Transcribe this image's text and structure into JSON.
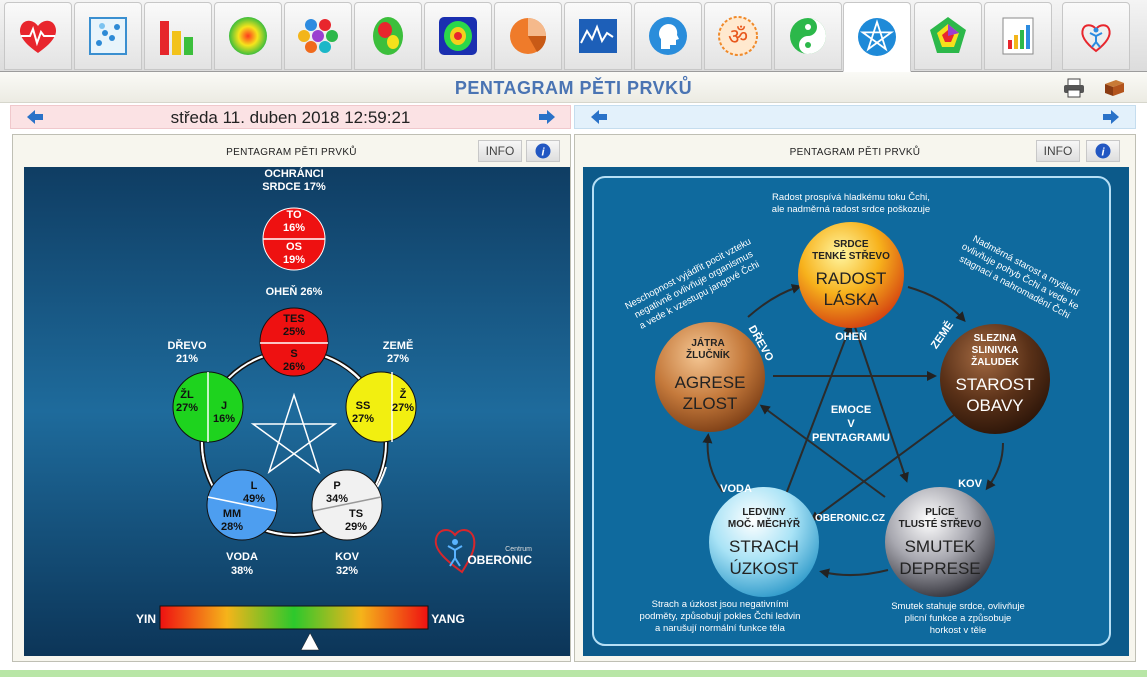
{
  "toolbar": {
    "tabs": [
      {
        "name": "heart-ecg-icon"
      },
      {
        "name": "scatter-icon"
      },
      {
        "name": "bar-chart-icon"
      },
      {
        "name": "radial-gradient-icon"
      },
      {
        "name": "hexagons-icon"
      },
      {
        "name": "brain-map-icon"
      },
      {
        "name": "body-scan-icon"
      },
      {
        "name": "pie-chart-icon"
      },
      {
        "name": "line-chart-icon"
      },
      {
        "name": "head-profile-icon"
      },
      {
        "name": "om-icon"
      },
      {
        "name": "yin-yang-icon"
      },
      {
        "name": "pentagram-icon",
        "active": true
      },
      {
        "name": "pentagon-chart-icon"
      },
      {
        "name": "report-icon"
      },
      {
        "name": "oberonic-logo-icon"
      }
    ]
  },
  "header": {
    "title": "PENTAGRAM PĚTI PRVKŮ",
    "icons": [
      "printer-icon",
      "book-icon"
    ]
  },
  "left": {
    "date": "středa 11. duben 2018 12:59:21",
    "panel_title": "PENTAGRAM PĚTI PRVKŮ",
    "info_label": "INFO",
    "ochranci": [
      "OCHRÁNCI",
      "SRDCE 17%"
    ],
    "top_circle": {
      "top": [
        "TO",
        "16%"
      ],
      "bottom": [
        "OS",
        "19%"
      ]
    },
    "fire": {
      "label": "OHEŇ 26%",
      "top": [
        "TES",
        "25%"
      ],
      "bottom": [
        "S",
        "26%"
      ],
      "color": "#ee1111"
    },
    "wood": {
      "label": [
        "DŘEVO",
        "21%"
      ],
      "outer": [
        "ŽL",
        "27%"
      ],
      "inner": [
        "J",
        "16%"
      ],
      "color": "#1ed31e"
    },
    "earth": {
      "label": [
        "ZEMĚ",
        "27%"
      ],
      "inner": [
        "SS",
        "27%"
      ],
      "outer": [
        "Ž",
        "27%"
      ],
      "color": "#f2ef10"
    },
    "water": {
      "label": [
        "VODA",
        "38%"
      ],
      "top": [
        "L",
        "49%"
      ],
      "bottom": [
        "MM",
        "28%"
      ],
      "color": "#4d9ef0"
    },
    "metal": {
      "label": [
        "KOV",
        "32%"
      ],
      "top": [
        "P",
        "34%"
      ],
      "bottom": [
        "TS",
        "29%"
      ],
      "color": "#f1f1f1"
    },
    "scale": {
      "yin": "YIN",
      "yang": "YANG",
      "marker": 0.56
    },
    "logo": {
      "small": "Centrum",
      "big": "OBERONIC"
    }
  },
  "right": {
    "panel_title": "PENTAGRAM PĚTI PRVKŮ",
    "info_label": "INFO",
    "center": [
      "EMOCE",
      "V",
      "PENTAGRAMU"
    ],
    "watermark": "OBERONIC.CZ",
    "fire": {
      "organ": [
        "SRDCE",
        "TENKÉ STŘEVO"
      ],
      "emotion": [
        "RADOST",
        "LÁSKA"
      ],
      "tag": "OHEŇ",
      "note": [
        "Radost prospívá hladkému toku Čchi,",
        "ale nadměrná radost srdce poškozuje"
      ]
    },
    "wood": {
      "organ": [
        "JÁTRA",
        "ŽLUČNÍK"
      ],
      "emotion": [
        "AGRESE",
        "ZLOST"
      ],
      "tag": "DŘEVO",
      "note": [
        "Neschopnost vyjádřit pocit vzteku",
        "negativně ovlivňuje organismus",
        "a vede k vzestupu jangové Čchi"
      ]
    },
    "earth": {
      "organ": [
        "SLEZINA",
        "SLINIVKA",
        "ŽALUDEK"
      ],
      "emotion": [
        "STAROST",
        "OBAVY"
      ],
      "tag": "ZEMĚ",
      "note": [
        "Nadměrná starost a myšlení",
        "ovlivňuje pohyb Čchi a vede ke",
        "stagnaci a nahromadění Čchi"
      ]
    },
    "water": {
      "organ": [
        "LEDVINY",
        "MOČ. MĚCHÝŘ"
      ],
      "emotion": [
        "STRACH",
        "ÚZKOST"
      ],
      "tag": "VODA",
      "note": [
        "Strach a úzkost jsou negativními",
        "podměty, způsobují pokles Čchi ledvin",
        "a narušují normální funkce těla"
      ]
    },
    "metal": {
      "organ": [
        "PLÍCE",
        "TLUSTÉ STŘEVO"
      ],
      "emotion": [
        "SMUTEK",
        "DEPRESE"
      ],
      "tag": "KOV",
      "note": [
        "Smutek stahuje srdce, ovlivňuje",
        "plicní funkce a způsobuje",
        "horkost v těle"
      ]
    }
  }
}
